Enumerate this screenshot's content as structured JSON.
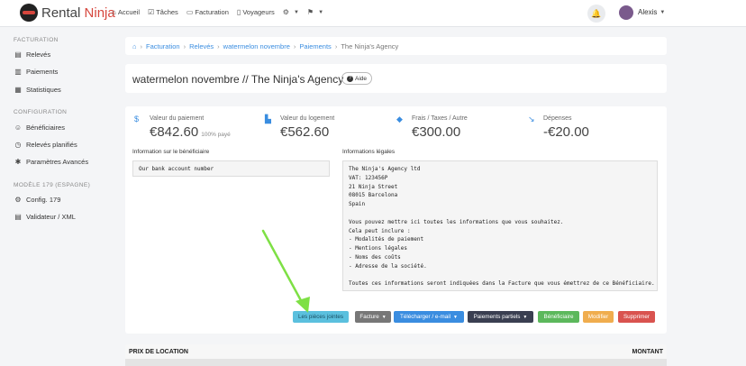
{
  "brand": {
    "name_part1": "Rental",
    "name_part2": "Ninja"
  },
  "nav": {
    "items": [
      {
        "icon": "home-icon",
        "glyph": "⌂",
        "label": "Accueil"
      },
      {
        "icon": "tasks-icon",
        "glyph": "☑",
        "label": "Tâches"
      },
      {
        "icon": "invoice-icon",
        "glyph": "▭",
        "label": "Facturation"
      },
      {
        "icon": "travelers-icon",
        "glyph": "▯",
        "label": "Voyageurs"
      }
    ],
    "settings_glyph": "⚙",
    "flag_glyph": "⚑"
  },
  "user": {
    "name": "Alexis"
  },
  "sidebar": {
    "sections": [
      {
        "heading": "Facturation",
        "items": [
          {
            "icon": "document-icon",
            "glyph": "▤",
            "label": "Relevés"
          },
          {
            "icon": "bank-icon",
            "glyph": "▥",
            "label": "Paiements"
          },
          {
            "icon": "chart-icon",
            "glyph": "▦",
            "label": "Statistiques"
          }
        ]
      },
      {
        "heading": "Configuration",
        "items": [
          {
            "icon": "users-icon",
            "glyph": "☺",
            "label": "Bénéficiaires"
          },
          {
            "icon": "alarm-icon",
            "glyph": "◷",
            "label": "Relevés planifiés"
          },
          {
            "icon": "puzzle-icon",
            "glyph": "✱",
            "label": "Paramètres Avancés"
          }
        ]
      },
      {
        "heading": "Modèle 179 (Espagne)",
        "items": [
          {
            "icon": "gear-icon",
            "glyph": "⚙",
            "label": "Config. 179"
          },
          {
            "icon": "list-icon",
            "glyph": "▤",
            "label": "Validateur / XML"
          }
        ]
      }
    ]
  },
  "breadcrumb": {
    "items": [
      "Facturation",
      "Relevés",
      "watermelon novembre",
      "Paiements"
    ],
    "current": "The Ninja's Agency"
  },
  "page": {
    "title": "watermelon novembre // The Ninja's Agency",
    "help_label": "Aide"
  },
  "stats": [
    {
      "icon": "dollar-icon",
      "glyph": "$",
      "label": "Valeur du paiement",
      "value": "€842.60",
      "sub": "100% payé"
    },
    {
      "icon": "building-icon",
      "glyph": "▙",
      "label": "Valeur du logement",
      "value": "€562.60",
      "sub": ""
    },
    {
      "icon": "tag-icon",
      "glyph": "◆",
      "label": "Frais / Taxes / Autre",
      "value": "€300.00",
      "sub": ""
    },
    {
      "icon": "trend-down-icon",
      "glyph": "↘",
      "label": "Dépenses",
      "value": "-€20.00",
      "sub": ""
    }
  ],
  "beneficiary": {
    "label": "Information sur le bénéficiaire",
    "text": "Our bank account number"
  },
  "legal": {
    "label": "Informations légales",
    "text": "The Ninja's Agency ltd\nVAT: 123456P\n21 Ninja Street\n08015 Barcelona\nSpain\n\nVous pouvez mettre ici toutes les informations que vous souhaitez.\nCela peut inclure :\n- Modalités de paiement\n- Mentions légales\n- Noms des coûts\n- Adresse de la société.\n\nToutes ces informations seront indiquées dans la Facture que vous émettrez de ce Bénéficiaire."
  },
  "actions": {
    "attachments": "Les pièces jointes",
    "invoice": "Facture",
    "download": "Télécharger / e-mail",
    "partial": "Paiements partiels",
    "beneficiary": "Bénéficiaire",
    "edit": "Modifier",
    "delete": "Supprimer"
  },
  "colors": {
    "link": "#3a8de0",
    "attachments": "#5bc0de",
    "invoice": "#777777",
    "download": "#3a8de0",
    "partial": "#3a3f51",
    "beneficiary": "#5cb85c",
    "edit": "#f0ad4e",
    "delete": "#d9534f",
    "arrow": "#7ee045"
  },
  "table": {
    "col_left": "PRIX DE LOCATION",
    "col_right": "MONTANT"
  }
}
